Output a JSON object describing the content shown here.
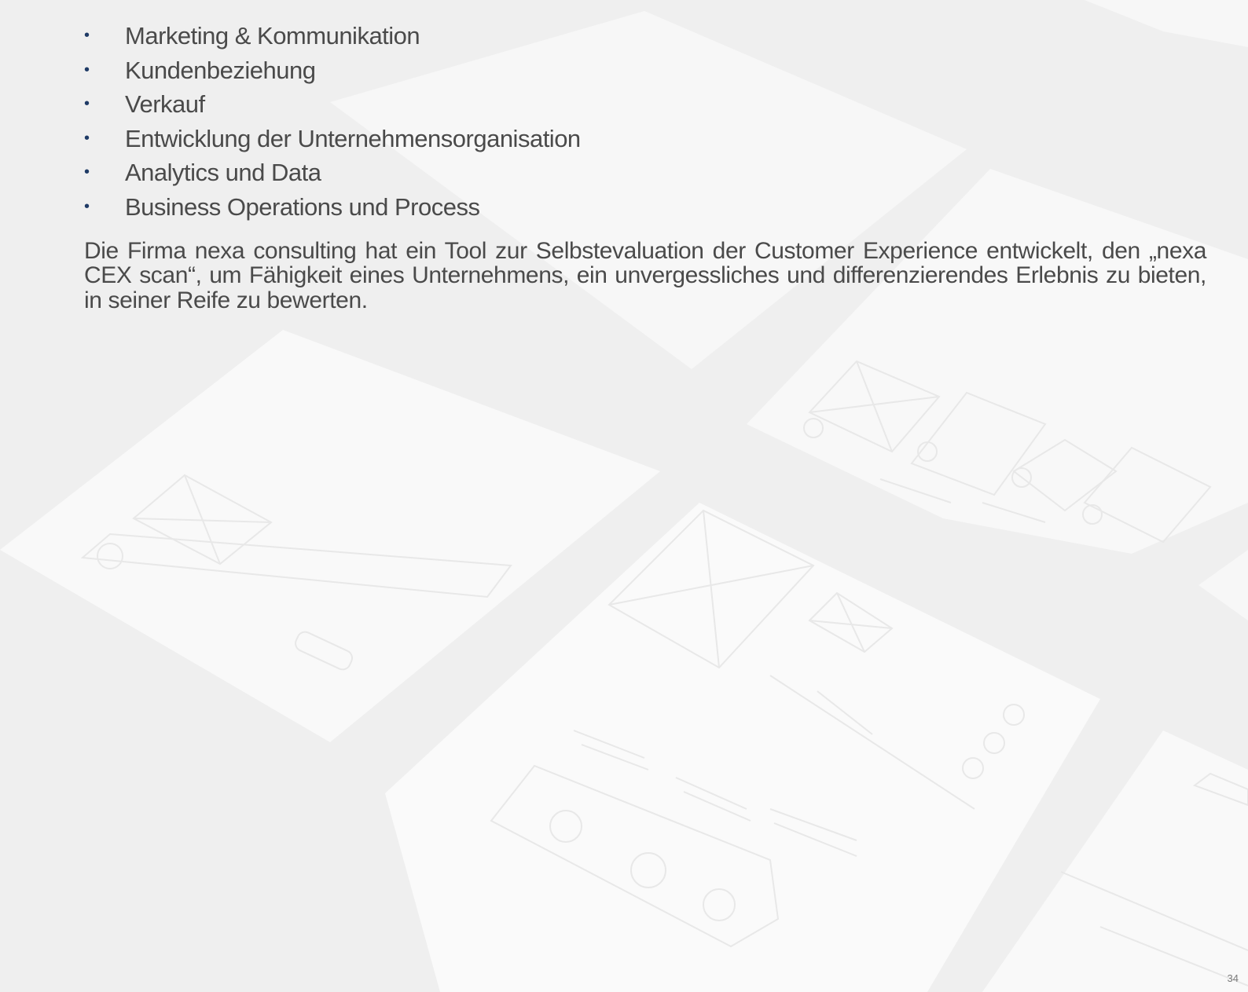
{
  "bullets": [
    "Marketing & Kommunikation",
    "Kundenbeziehung",
    "Verkauf",
    "Entwicklung der Unternehmensorganisation",
    "Analytics und Data",
    "Business Operations und Process"
  ],
  "bullet_symbol": "•",
  "paragraph": "Die Firma nexa consulting hat ein Tool zur Selbstevaluation der Customer Experience entwickelt, den „nexa CEX scan“, um Fähigkeit eines Unternehmens, ein unvergessliches und differenzierendes Erlebnis zu bieten, in seiner Reife zu bewerten.",
  "page_number": "34",
  "colors": {
    "background": "#f3f3f3",
    "paper": "#f9f9f9",
    "text": "#4a4a4a",
    "bullet": "#1f3b66"
  }
}
